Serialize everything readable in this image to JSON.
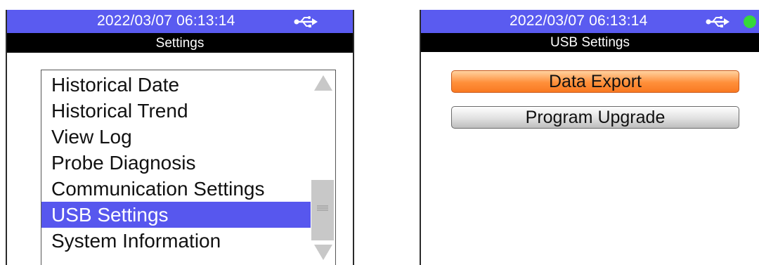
{
  "left_screen": {
    "status": {
      "datetime": "2022/03/07 06:13:14",
      "usb_icon": "usb-icon"
    },
    "title": "Settings",
    "menu": {
      "items": [
        {
          "label": "Historical Date"
        },
        {
          "label": "Historical Trend"
        },
        {
          "label": "View Log"
        },
        {
          "label": "Probe Diagnosis"
        },
        {
          "label": "Communication Settings"
        },
        {
          "label": "USB Settings",
          "selected": true
        },
        {
          "label": "System Information"
        }
      ],
      "scrollbar_icons": [
        "arrow-up-icon",
        "scroll-grip-icon",
        "arrow-down-icon"
      ]
    }
  },
  "right_screen": {
    "status": {
      "datetime": "2022/03/07 06:13:14",
      "usb_icon": "usb-icon",
      "indicator": "status-dot"
    },
    "title": "USB Settings",
    "buttons": [
      {
        "label": "Data Export",
        "selected": true
      },
      {
        "label": "Program Upgrade"
      }
    ]
  },
  "colors": {
    "status_bar": "#5a5bf0",
    "title_bar": "#000000",
    "selection": "#5757ee",
    "selected_button": "#ff8f3a",
    "status_dot": "#35d93a"
  }
}
